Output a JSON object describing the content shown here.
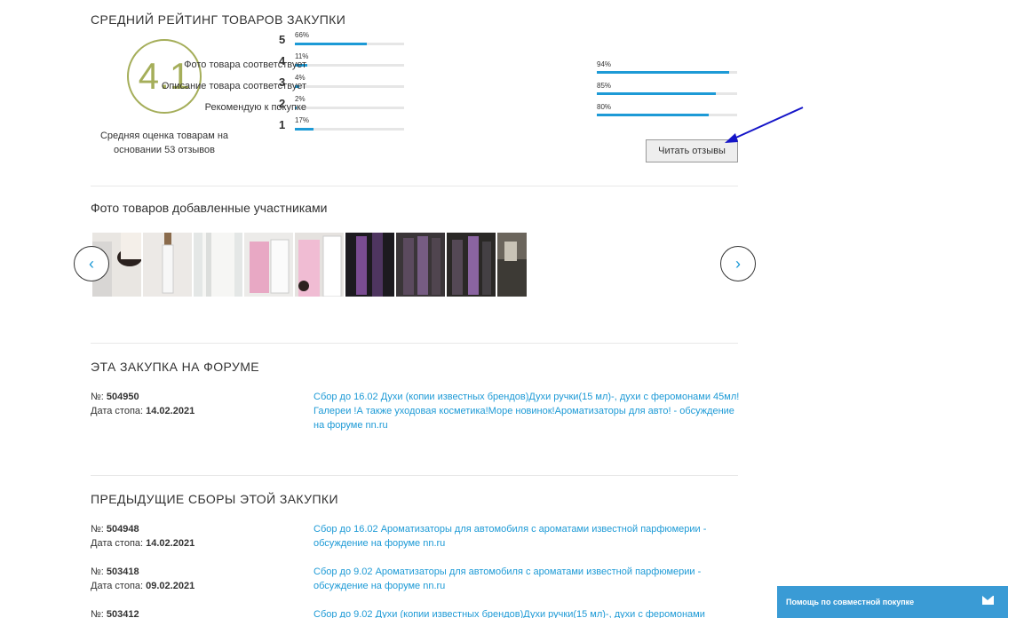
{
  "rating": {
    "title": "СРЕДНИЙ РЕЙТИНГ ТОВАРОВ ЗАКУПКИ",
    "average": "4.1",
    "caption": "Средняя оценка товарам на основании 53 отзывов",
    "accent_color": "#a5ae5a",
    "stars": [
      {
        "num": "5",
        "pct": "66%",
        "value": 0.66
      },
      {
        "num": "4",
        "pct": "11%",
        "value": 0.11
      },
      {
        "num": "3",
        "pct": "4%",
        "value": 0.04
      },
      {
        "num": "2",
        "pct": "2%",
        "value": 0.02
      },
      {
        "num": "1",
        "pct": "17%",
        "value": 0.17
      }
    ],
    "criteria": [
      {
        "label": "Фото товара соответствует",
        "pct": "94%",
        "value": 0.94
      },
      {
        "label": "Описание товара соответствует",
        "pct": "85%",
        "value": 0.85
      },
      {
        "label": "Рекомендую к покупке",
        "pct": "80%",
        "value": 0.8
      }
    ],
    "read_button": "Читать отзывы",
    "bar_color": "#1d9ad6"
  },
  "photos": {
    "title": "Фото товаров добавленные участниками",
    "prev_icon": "chevron-left-icon",
    "next_icon": "chevron-right-icon"
  },
  "forum": {
    "title": "ЭТА ЗАКУПКА НА ФОРУМЕ",
    "number_label": "№:",
    "number": "504950",
    "date_label": "Дата стопа:",
    "date": "14.02.2021",
    "link": "Сбор до 16.02 Духи (копии известных брендов)Духи ручки(15 мл)-, духи с феромонами 45мл!Галереи !А также уходовая косметика!Море новинок!Ароматизаторы для авто! - обсуждение на форуме nn.ru"
  },
  "previous": {
    "title": "ПРЕДЫДУЩИЕ СБОРЫ ЭТОЙ ЗАКУПКИ",
    "items": [
      {
        "number_label": "№:",
        "number": "504948",
        "date_label": "Дата стопа:",
        "date": "14.02.2021",
        "link": "Сбор до 16.02 Ароматизаторы для автомобиля с ароматами известной парфюмерии - обсуждение на форуме nn.ru"
      },
      {
        "number_label": "№:",
        "number": "503418",
        "date_label": "Дата стопа:",
        "date": "09.02.2021",
        "link": "Сбор до 9.02 Ароматизаторы для автомобиля с ароматами известной парфюмерии - обсуждение на форуме nn.ru"
      },
      {
        "number_label": "№:",
        "number": "503412",
        "date_label": "",
        "date": "",
        "link": "Сбор до 9.02 Духи (копии известных брендов)Духи ручки(15 мл)-, духи с феромонами"
      }
    ]
  },
  "help_widget": {
    "label": "Помощь по совместной покупке",
    "icon": "mail-icon",
    "color": "#3a9bd5"
  }
}
